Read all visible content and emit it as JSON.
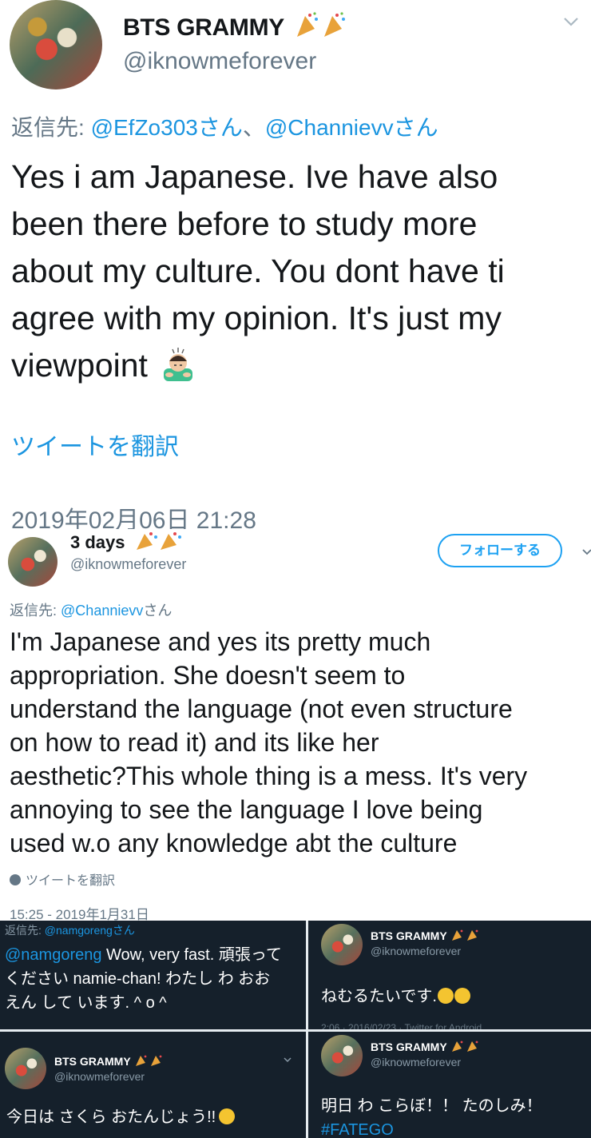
{
  "tweet1": {
    "display_name": "BTS GRAMMY",
    "display_name_emoji": "party-popper-icon x2",
    "handle": "@iknowmeforever",
    "reply_prefix": "返信先:",
    "reply_mention_1": "@EfZo303さん",
    "reply_separator": "、",
    "reply_mention_2": "@Channievvさん",
    "body_lines": [
      "Yes i am Japanese. Ive have also",
      "been there before to study more",
      "about my culture. You dont have ti",
      "agree with my opinion. It's just my",
      "viewpoint"
    ],
    "body_emoji": "man-bowing-icon",
    "translate_label": "ツイートを翻訳",
    "timestamp": "2019年02月06日 21:28"
  },
  "tweet2": {
    "display_name": "3 days",
    "handle": "@iknowmeforever",
    "follow_label": "フォローする",
    "reply_prefix": "返信先:",
    "reply_mention": "@Channievv",
    "reply_suffix": "さん",
    "body_lines": [
      "I'm Japanese and yes its pretty much",
      "appropriation. She doesn't seem to",
      "understand the language (not even structure",
      "on how to read it) and its like her",
      "aesthetic?This whole thing is a mess. It's very",
      "annoying to see the language I love being",
      "used w.o any knowledge abt the culture"
    ],
    "translate_label": "ツイートを翻訳",
    "timestamp": "15:25 - 2019年1月31日"
  },
  "grid": {
    "cell1": {
      "reply_prefix": "返信先:",
      "reply_mention": "@namgorengさん",
      "mention": "@namgoreng",
      "line1_rest": " Wow, very fast. 頑張って",
      "line2": "ください namie-chan! わたし わ おお",
      "line3": "えん して います. ^ o ^"
    },
    "cell2": {
      "display_name": "BTS GRAMMY",
      "handle": "@iknowmeforever",
      "text": "ねむるたいです.",
      "footer": "2:06 · 2016/02/23 · Twitter for Android"
    },
    "cell3": {
      "display_name": "BTS GRAMMY",
      "handle": "@iknowmeforever",
      "text": "今日は さくら おたんじょう!!"
    },
    "cell4": {
      "display_name": "BTS GRAMMY",
      "handle": "@iknowmeforever",
      "text": "明日 わ こらぼ！！ たのしみ！",
      "hashtag": "#FATEGO"
    }
  },
  "colors": {
    "link": "#1b95e0",
    "muted": "#657786",
    "dark_bg": "#15202b",
    "follow_border": "#1da1f2"
  }
}
